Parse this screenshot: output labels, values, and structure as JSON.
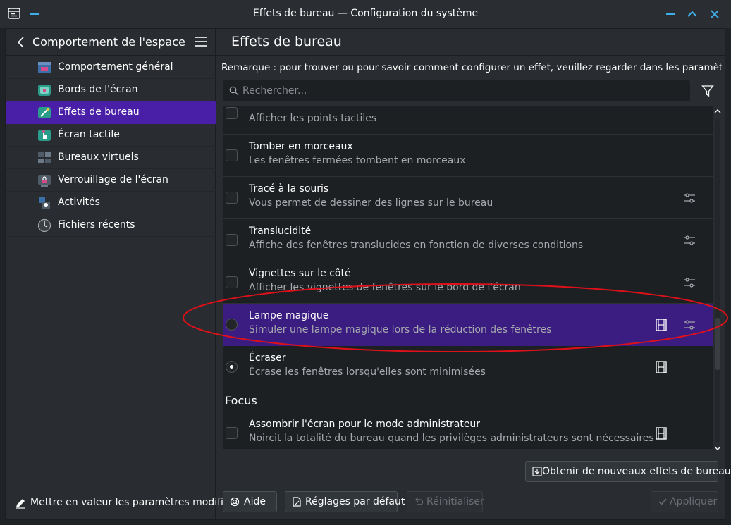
{
  "window": {
    "title": "Effets de bureau — Configuration du système"
  },
  "sidebar": {
    "title": "Comportement de l'espace d...",
    "items": [
      {
        "label": "Comportement général",
        "icon": "general-behavior-icon"
      },
      {
        "label": "Bords de l'écran",
        "icon": "screen-edges-icon"
      },
      {
        "label": "Effets de bureau",
        "icon": "desktop-effects-icon",
        "active": true
      },
      {
        "label": "Écran tactile",
        "icon": "touchscreen-icon"
      },
      {
        "label": "Bureaux virtuels",
        "icon": "virtual-desktops-icon"
      },
      {
        "label": "Verrouillage de l'écran",
        "icon": "screen-lock-icon"
      },
      {
        "label": "Activités",
        "icon": "activities-icon"
      },
      {
        "label": "Fichiers récents",
        "icon": "recent-files-icon"
      }
    ],
    "footer_label": "Mettre en valeur les paramètres modifiés"
  },
  "main": {
    "title": "Effets de bureau",
    "remark": "Remarque : pour trouver ou pour savoir comment configurer un effet, veuillez regarder dans les paramètres de l...",
    "search_placeholder": "Rechercher...",
    "effects": [
      {
        "name": "",
        "desc": "Afficher les points tactiles",
        "control": "checkbox"
      },
      {
        "name": "Tomber en morceaux",
        "desc": "Les fenêtres fermées tombent en morceaux",
        "control": "checkbox"
      },
      {
        "name": "Tracé à la souris",
        "desc": "Vous permet de dessiner des lignes sur le bureau",
        "control": "checkbox",
        "configure": true
      },
      {
        "name": "Translucidité",
        "desc": "Affiche des fenêtres translucides en fonction de diverses conditions",
        "control": "checkbox",
        "configure": true
      },
      {
        "name": "Vignettes sur le côté",
        "desc": "Afficher les vignettes de fenêtres sur le bord de l'écran",
        "control": "checkbox",
        "configure": true
      },
      {
        "name": "Lampe magique",
        "desc": "Simuler une lampe magique lors de la réduction des fenêtres",
        "control": "radio",
        "checked": false,
        "video": true,
        "configure": true,
        "selected": true
      },
      {
        "name": "Écraser",
        "desc": "Écrase les fenêtres lorsqu'elles sont minimisées",
        "control": "radio",
        "checked": true,
        "video": true
      }
    ],
    "section_focus": "Focus",
    "focus_effects": [
      {
        "name": "Assombrir l'écran pour le mode administrateur",
        "desc": "Noircit la totalité du bureau quand les privilèges administrateurs sont nécessaires",
        "control": "checkbox",
        "video": true
      }
    ],
    "get_new_label": "Obtenir de nouveaux effets de bureau...",
    "buttons": {
      "help": "Aide",
      "defaults": "Réglages par défaut",
      "reset": "Réinitialiser",
      "apply": "Appliquer"
    }
  },
  "colors": {
    "accent": "#3daee9",
    "selection": "#4a1fa8",
    "annotation": "#e0101a"
  }
}
